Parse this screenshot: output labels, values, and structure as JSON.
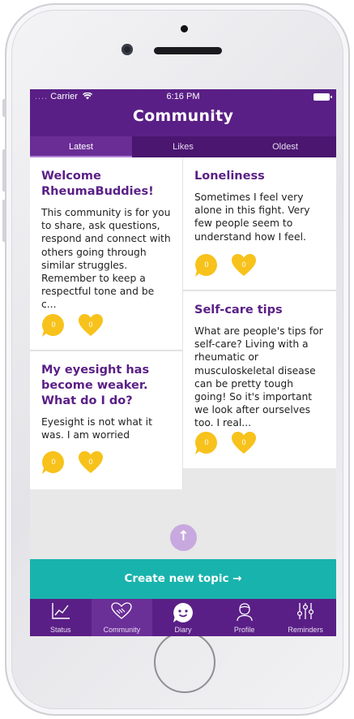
{
  "status_bar": {
    "carrier": "Carrier",
    "dots": "....",
    "time": "6:16 PM"
  },
  "header": {
    "title": "Community"
  },
  "tabs": [
    {
      "label": "Latest",
      "active": true
    },
    {
      "label": "Likes",
      "active": false
    },
    {
      "label": "Oldest",
      "active": false
    }
  ],
  "topics": [
    {
      "title": "Welcome RheumaBuddies!",
      "body": "This community is for you to share, ask questions, respond and connect with others going through similar struggles. Remember to keep a respectful tone and be c...",
      "comments": "0",
      "likes": "0"
    },
    {
      "title": "Loneliness",
      "body": "Sometimes I feel very alone in this fight. Very few people seem to understand how I feel.",
      "comments": "0",
      "likes": "0"
    },
    {
      "title": "My eyesight has become weaker. What do I do?",
      "body": "Eyesight is not what it was. I am worried",
      "comments": "0",
      "likes": "0"
    },
    {
      "title": "Self-care tips",
      "body": "What are people's tips for self-care? Living with a rheumatic or musculoskeletal disease can be pretty tough going! So it's important we look after ourselves too. I real...",
      "comments": "0",
      "likes": "0"
    }
  ],
  "scroll_up_icon": "arrow-up-icon",
  "create_button": {
    "label": "Create new topic →"
  },
  "bottom_nav": [
    {
      "label": "Status",
      "icon": "chart-icon",
      "active": false
    },
    {
      "label": "Community",
      "icon": "handshake-heart-icon",
      "active": true
    },
    {
      "label": "Diary",
      "icon": "smiley-bubble-icon",
      "active": false
    },
    {
      "label": "Profile",
      "icon": "person-icon",
      "active": false
    },
    {
      "label": "Reminders",
      "icon": "sliders-icon",
      "active": false
    }
  ],
  "colors": {
    "brand_purple": "#5a1f86",
    "teal": "#19b3ad",
    "reaction_yellow": "#f7c21b"
  }
}
